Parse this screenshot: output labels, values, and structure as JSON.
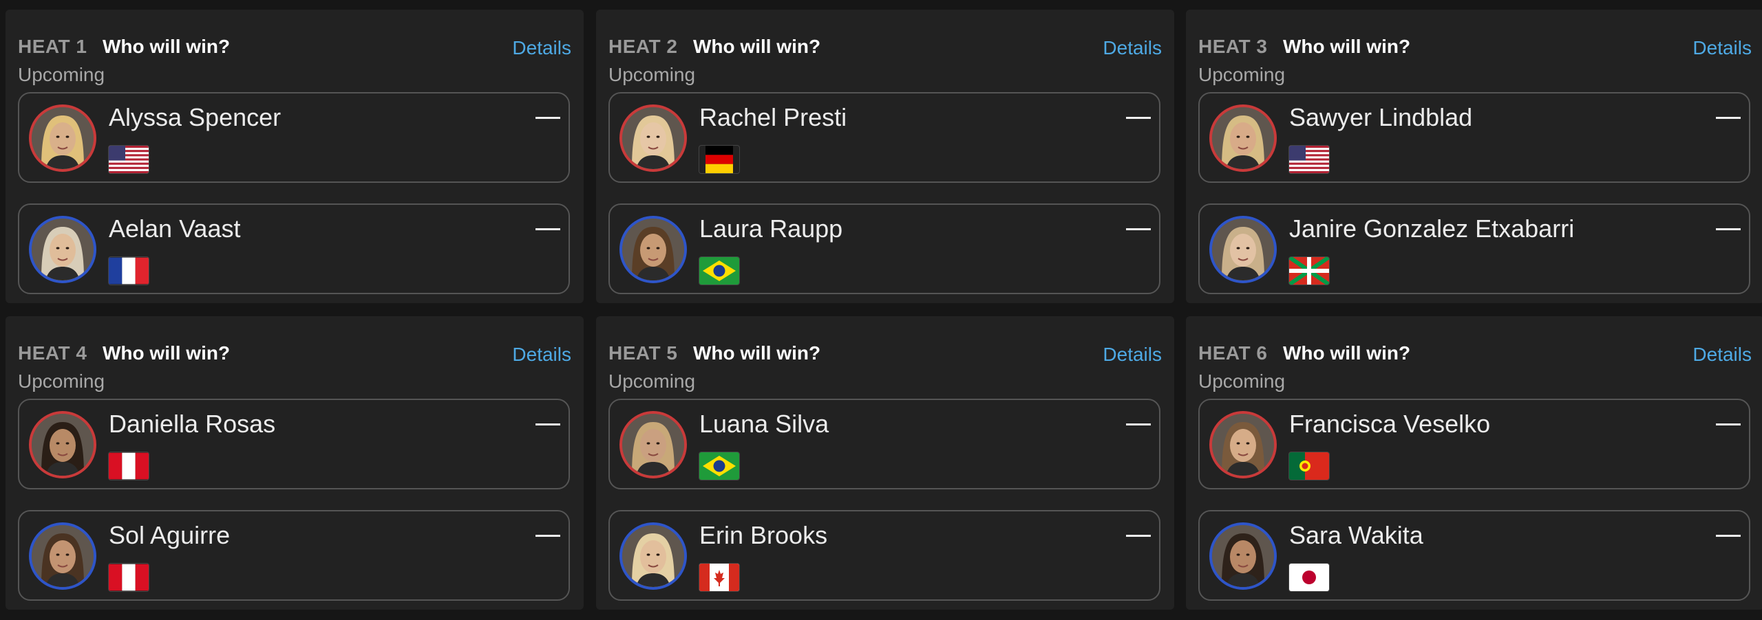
{
  "question_label": "Who will win?",
  "details_label": "Details",
  "heats": [
    {
      "title": "HEAT 1",
      "status": "Upcoming",
      "surfers": [
        {
          "name": "Alyssa Spencer",
          "country": "United States",
          "flag": "us",
          "skin": "#d9b08a",
          "hair": "#e0c07a",
          "result": "—"
        },
        {
          "name": "Aelan Vaast",
          "country": "France",
          "flag": "fr",
          "skin": "#e0bd9a",
          "hair": "#d8cdb8",
          "result": "—"
        }
      ]
    },
    {
      "title": "HEAT 2",
      "status": "Upcoming",
      "surfers": [
        {
          "name": "Rachel Presti",
          "country": "Germany",
          "flag": "de",
          "skin": "#e6c7a6",
          "hair": "#e2c898",
          "result": "—"
        },
        {
          "name": "Laura Raupp",
          "country": "Brazil",
          "flag": "br",
          "skin": "#c79a74",
          "hair": "#5a3e26",
          "result": "—"
        }
      ]
    },
    {
      "title": "HEAT 3",
      "status": "Upcoming",
      "surfers": [
        {
          "name": "Sawyer Lindblad",
          "country": "United States",
          "flag": "us",
          "skin": "#d8ab88",
          "hair": "#d6bc84",
          "result": "—"
        },
        {
          "name": "Janire Gonzalez Etxabarri",
          "country": "Basque Country",
          "flag": "eu",
          "skin": "#e2c2a4",
          "hair": "#c9b08a",
          "result": "—"
        }
      ]
    },
    {
      "title": "HEAT 4",
      "status": "Upcoming",
      "surfers": [
        {
          "name": "Daniella Rosas",
          "country": "Peru",
          "flag": "pe",
          "skin": "#b88a66",
          "hair": "#2a1e16",
          "result": "—"
        },
        {
          "name": "Sol Aguirre",
          "country": "Peru",
          "flag": "pe",
          "skin": "#c39472",
          "hair": "#4a3322",
          "result": "—"
        }
      ]
    },
    {
      "title": "HEAT 5",
      "status": "Upcoming",
      "surfers": [
        {
          "name": "Luana Silva",
          "country": "Brazil",
          "flag": "br",
          "skin": "#caa080",
          "hair": "#c8a878",
          "result": "—"
        },
        {
          "name": "Erin Brooks",
          "country": "Canada",
          "flag": "ca",
          "skin": "#e2bf9c",
          "hair": "#e4d0a4",
          "result": "—"
        }
      ]
    },
    {
      "title": "HEAT 6",
      "status": "Upcoming",
      "surfers": [
        {
          "name": "Francisca Veselko",
          "country": "Portugal",
          "flag": "pt",
          "skin": "#d6ac88",
          "hair": "#7a5a3c",
          "result": "—"
        },
        {
          "name": "Sara Wakita",
          "country": "Japan",
          "flag": "jp",
          "skin": "#b88866",
          "hair": "#2e221a",
          "result": "—"
        }
      ]
    }
  ],
  "colors": {
    "accent": "#4ea9e4",
    "red_ring": "#c93a3a",
    "blue_ring": "#2e55c9",
    "card": "#222222",
    "background": "#161616"
  }
}
